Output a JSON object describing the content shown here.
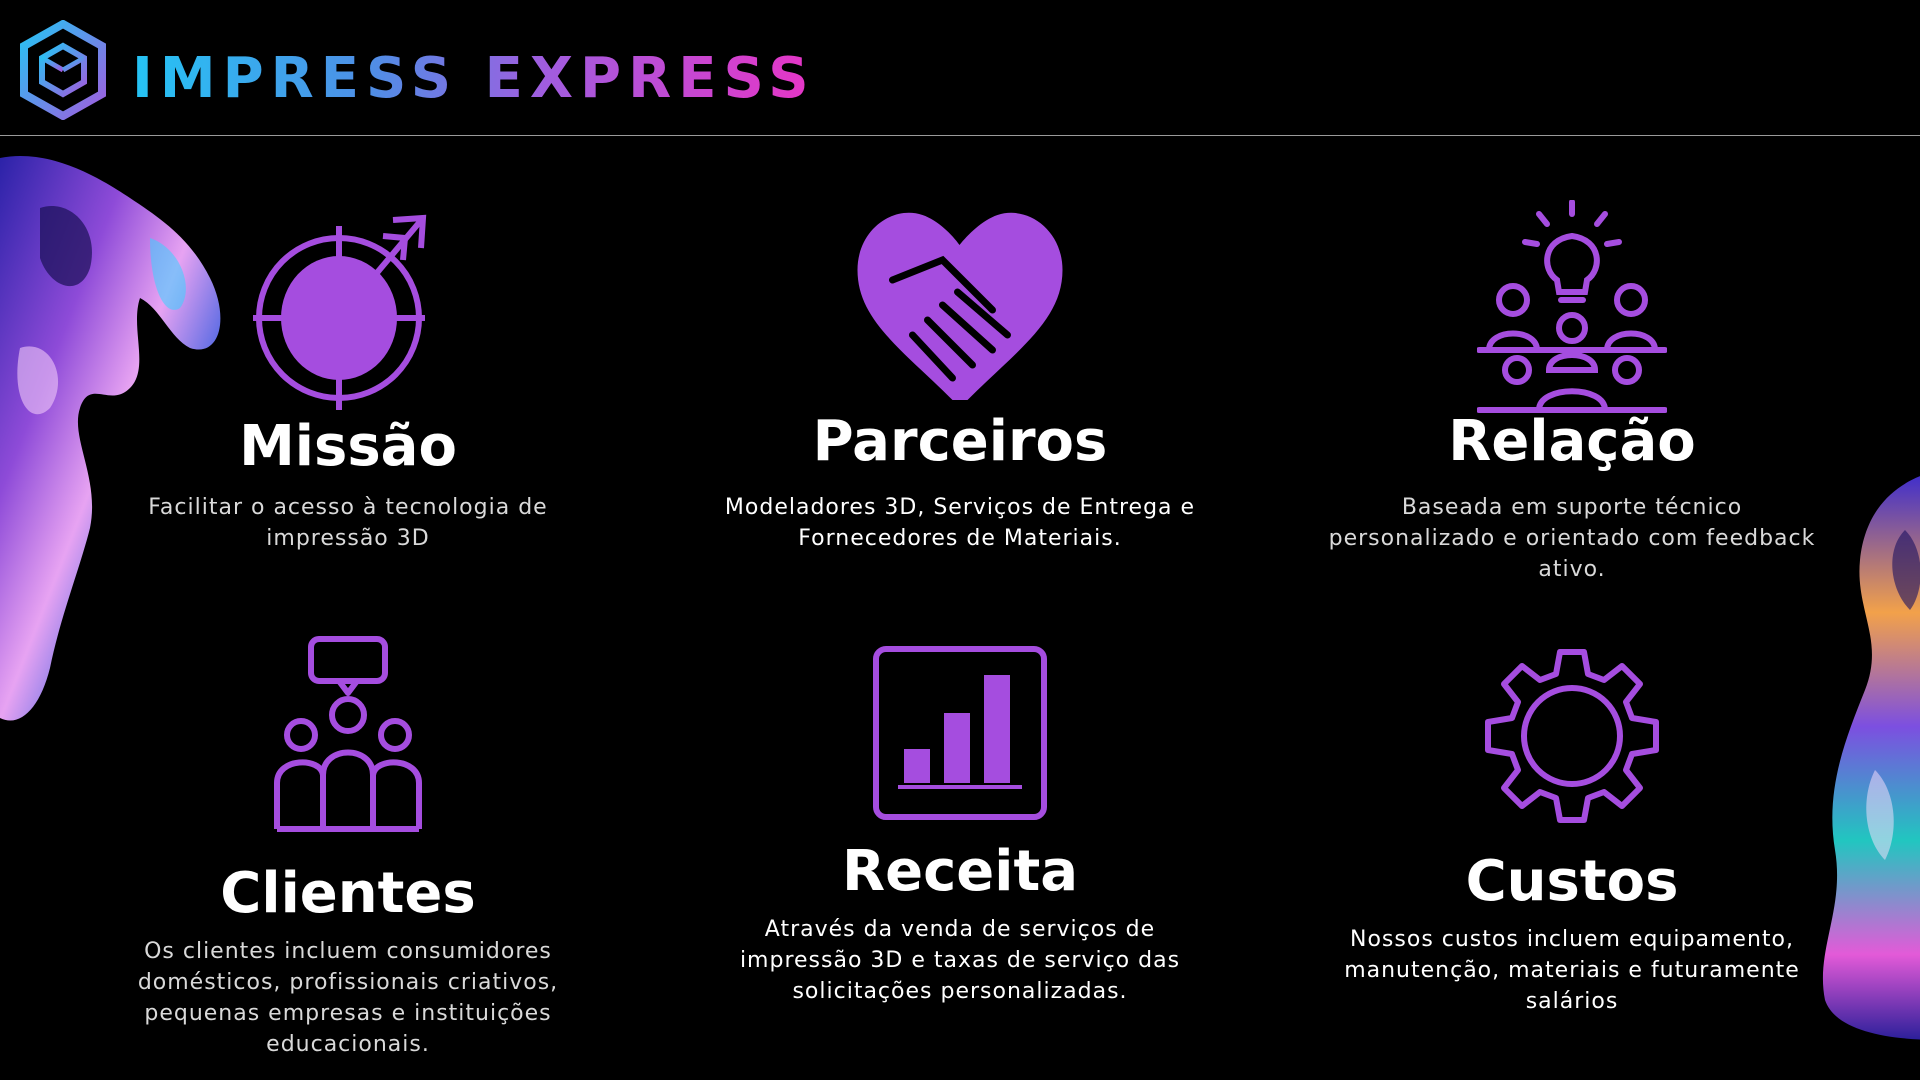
{
  "brand": {
    "name": "IMPRESS EXPRESS",
    "gradient": [
      "#25c4f4",
      "#a05ddf",
      "#e735c6"
    ]
  },
  "accent_color": "#a54ddf",
  "cards": [
    {
      "icon": "target-arrow-icon",
      "title": "Missão",
      "text": "Facilitar o acesso à tecnologia de impressão 3D"
    },
    {
      "icon": "handshake-heart-icon",
      "title": "Parceiros",
      "text": "Modeladores 3D, Serviços de Entrega e Fornecedores de Materiais."
    },
    {
      "icon": "team-lightbulb-icon",
      "title": "Relação",
      "text": "Baseada em suporte técnico personalizado e orientado com feedback ativo."
    },
    {
      "icon": "group-chat-icon",
      "title": "Clientes",
      "text": "Os clientes incluem consumidores domésticos, profissionais criativos, pequenas empresas e instituições educacionais."
    },
    {
      "icon": "bar-chart-icon",
      "title": "Receita",
      "text": "Através da venda de serviços de impressão 3D e taxas de serviço das solicitações personalizadas."
    },
    {
      "icon": "gear-icon",
      "title": "Custos",
      "text": "Nossos custos incluem equipamento, manutenção, materiais e futuramente salários"
    }
  ]
}
